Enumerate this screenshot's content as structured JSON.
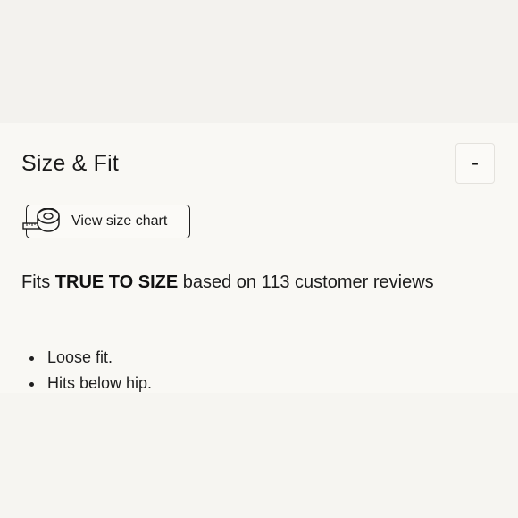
{
  "section": {
    "title": "Size & Fit",
    "collapse_label": "-",
    "size_chart_label": "View size chart",
    "fit_summary": {
      "prefix": "Fits ",
      "verdict": "TRUE TO SIZE",
      "suffix": " based on 113 customer reviews"
    },
    "notes": [
      "Loose fit.",
      "Hits below hip."
    ]
  },
  "icons": {
    "size_chart": "measuring-tape-icon"
  },
  "colors": {
    "background": "#f9f8f4",
    "text": "#1c1c1c"
  }
}
